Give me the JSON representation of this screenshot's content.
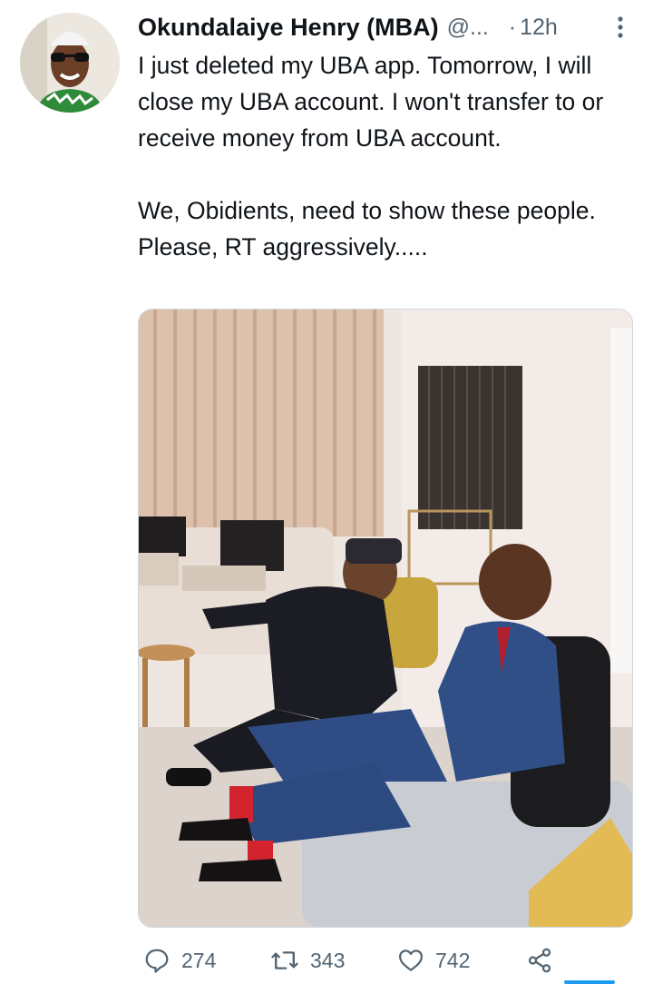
{
  "tweet": {
    "author_name": "Okundalaiye Henry (MBA)",
    "handle": "@...",
    "separator": "·",
    "time": "12h",
    "paragraphs": [
      "I just deleted my UBA app. Tomorrow, I will close my UBA account. I won't transfer to or receive money from UBA account.",
      "We, Obidients, need to show these people. Please, RT aggressively....."
    ]
  },
  "actions": {
    "reply_count": "274",
    "retweet_count": "343",
    "like_count": "742"
  },
  "icons": {
    "more": "more-vertical-icon",
    "reply": "comment-icon",
    "retweet": "retweet-icon",
    "like": "heart-icon",
    "share": "share-icon"
  },
  "colors": {
    "text": "#0f1419",
    "secondary": "#536471",
    "accent": "#1d9bf0"
  }
}
